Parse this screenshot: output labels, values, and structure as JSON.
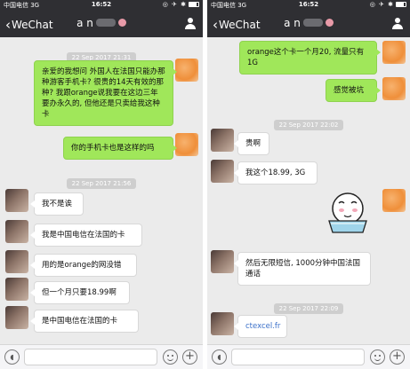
{
  "status_bar": {
    "carrier": "中国电信 3G",
    "time": "16:52"
  },
  "nav": {
    "back_label": "WeChat",
    "contact_name": "a n"
  },
  "left_chat": {
    "timestamps": [
      "22 Sep 2017 21:31",
      "22 Sep 2017 21:56"
    ],
    "messages": [
      {
        "from": "self",
        "text": "亲爱的我想问 外国人在法国只能办那种游客手机卡? 很贵的14天有效的那种? 我跟orange说我要在这边三年要办永久的, 但他还是只卖给我这种卡"
      },
      {
        "from": "self",
        "text": "你的手机卡也是这样的吗"
      },
      {
        "from": "other",
        "text": "我不是诶"
      },
      {
        "from": "other",
        "text": "我是中国电信在法国的卡"
      },
      {
        "from": "other",
        "text": "用的是orange的网没错"
      },
      {
        "from": "other",
        "text": "但一个月只要18.99啊"
      },
      {
        "from": "other",
        "text": "是中国电信在法国的卡"
      }
    ]
  },
  "right_chat": {
    "timestamps": [
      "22 Sep 2017 22:02",
      "22 Sep 2017 22:09"
    ],
    "messages": [
      {
        "from": "self",
        "text": "orange这个卡一个月20, 流量只有1G"
      },
      {
        "from": "self",
        "text": "感觉被坑"
      },
      {
        "from": "other",
        "text": "贵啊"
      },
      {
        "from": "other",
        "text": "我这个18.99, 3G"
      },
      {
        "from": "other",
        "text": "然后无限短信, 1000分钟中国法国通话"
      },
      {
        "from": "other",
        "text": "ctexcel.fr"
      }
    ]
  },
  "colors": {
    "header": "#2f2f33",
    "chat_bg": "#ebebeb",
    "self_bubble": "#a0e75a",
    "other_bubble": "#ffffff",
    "link": "#3b70c9"
  },
  "icons": [
    "back-chevron-icon",
    "person-icon",
    "voice-icon",
    "emoji-icon",
    "plus-icon",
    "sticker-image"
  ]
}
